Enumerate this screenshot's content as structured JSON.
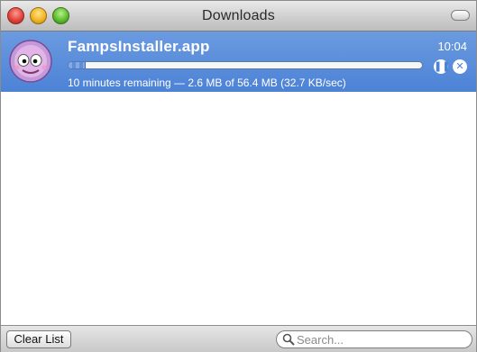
{
  "window": {
    "title": "Downloads"
  },
  "download": {
    "name": "FampsInstaller.app",
    "time": "10:04",
    "status": "10 minutes remaining — 2.6 MB of 56.4 MB  (32.7 KB/sec)",
    "progress_fraction": 0.046,
    "icons": {
      "app": "famps-app-icon",
      "pause": "pause-icon",
      "stop": "stop-icon"
    }
  },
  "bottombar": {
    "clear_label": "Clear List",
    "search_placeholder": "Search...",
    "icons": {
      "search": "search-icon"
    }
  },
  "colors": {
    "selection": "#4c82d6",
    "title_text": "#2a2a2a"
  }
}
